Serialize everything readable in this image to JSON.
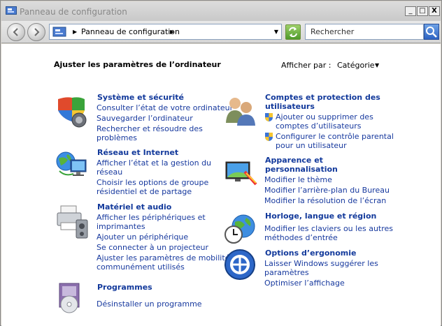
{
  "window": {
    "title": "Panneau de configuration",
    "min_label": "_",
    "max_label": "□",
    "close_label": "X"
  },
  "address": {
    "breadcrumb": "Panneau de configuration",
    "search_placeholder": "Rechercher"
  },
  "header": {
    "title": "Ajuster les paramètres de l’ordinateur",
    "view_by_label": "Afficher par :",
    "view_by_value": "Catégorie"
  },
  "categories": [
    {
      "title": "Système et sécurité",
      "links": [
        "Consulter l’état de votre ordinateur",
        "Sauvegarder l’ordinateur",
        "Rechercher et résoudre des",
        "problèmes"
      ],
      "icon": "shield-security-icon"
    },
    {
      "title": "Réseau et Internet",
      "links": [
        "Afficher l’état et la gestion du",
        "réseau",
        "Choisir les options de groupe",
        "résidentiel et de partage"
      ],
      "icon": "network-globe-icon"
    },
    {
      "title": "Matériel et audio",
      "links": [
        "Afficher les périphériques et",
        "imprimantes",
        "Ajouter un périphérique",
        "Se connecter à un projecteur",
        "Ajuster les paramètres de mobilité",
        "communément utilisés"
      ],
      "icon": "printer-hardware-icon"
    },
    {
      "title": "Programmes",
      "links": [
        "Désinstaller un programme"
      ],
      "icon": "programs-disc-icon"
    },
    {
      "title_line1": "Comptes et protection des",
      "title_line2": "utilisateurs",
      "links": [
        "Ajouter ou supprimer des",
        "comptes d’utilisateurs",
        "Configurer le contrôle parental",
        "pour un utilisateur"
      ],
      "icon": "users-icon"
    },
    {
      "title_line1": "Apparence et",
      "title_line2": "personnalisation",
      "links": [
        "Modifier le thème",
        "Modifier l’arrière-plan du Bureau",
        "Modifier la résolution de l’écran"
      ],
      "icon": "appearance-monitor-icon"
    },
    {
      "title": "Horloge, langue et région",
      "links": [
        "Modifier les claviers ou les autres",
        "méthodes d’entrée"
      ],
      "icon": "clock-globe-icon"
    },
    {
      "title": "Options d’ergonomie",
      "links": [
        "Laisser Windows suggérer les",
        "paramètres",
        "Optimiser l’affichage"
      ],
      "icon": "ease-of-access-icon"
    }
  ],
  "colors": {
    "link": "#17399e",
    "heading_link": "#12399b",
    "refresh_green": "#4e9a2a",
    "search_blue": "#2c62c2"
  }
}
